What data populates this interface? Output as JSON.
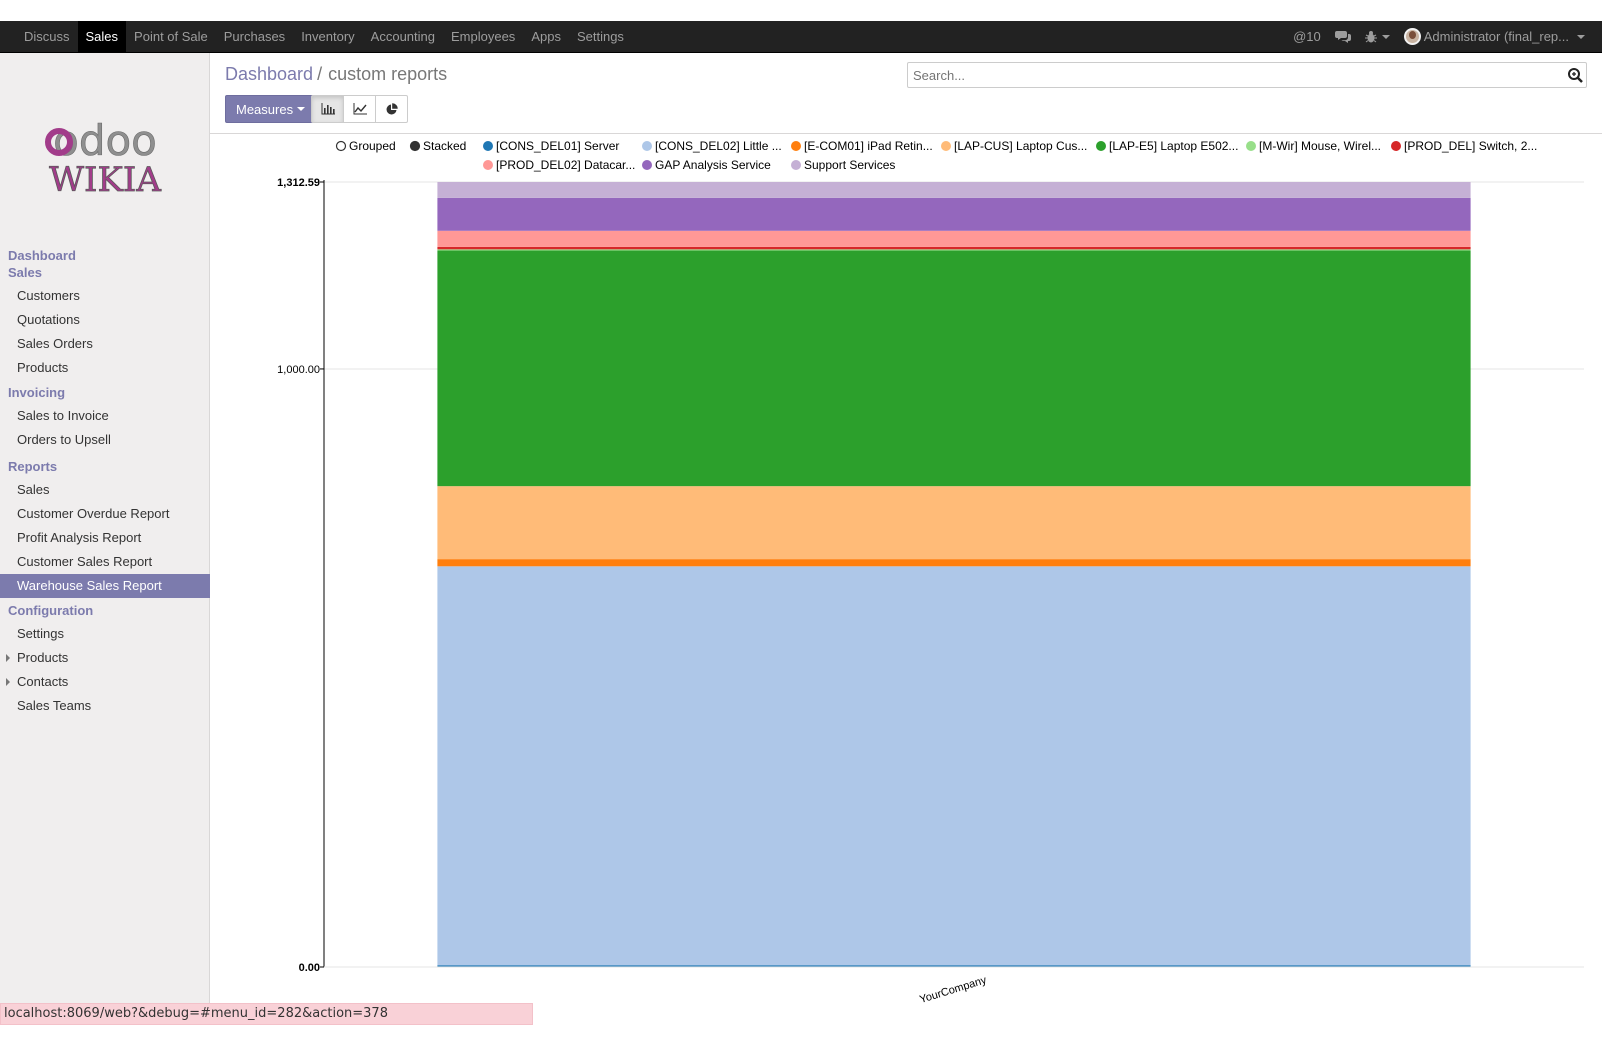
{
  "topbar": {
    "menu": [
      "Discuss",
      "Sales",
      "Point of Sale",
      "Purchases",
      "Inventory",
      "Accounting",
      "Employees",
      "Apps",
      "Settings"
    ],
    "active": "Sales",
    "mentions": "@10",
    "user": "Administrator (final_rep..."
  },
  "sidebar": {
    "logo_line1": "odoo",
    "logo_line2": "WIKIA",
    "sections": [
      {
        "title": "Dashboard",
        "items": []
      },
      {
        "title": "Sales",
        "items": [
          "Customers",
          "Quotations",
          "Sales Orders",
          "Products"
        ]
      },
      {
        "title": "Invoicing",
        "items": [
          "Sales to Invoice",
          "Orders to Upsell"
        ]
      },
      {
        "title": "Reports",
        "items": [
          "Sales",
          "Customer Overdue Report",
          "Profit Analysis Report",
          "Customer Sales Report",
          "Warehouse Sales Report"
        ]
      },
      {
        "title": "Configuration",
        "items": [
          "Settings",
          "Products",
          "Contacts",
          "Sales Teams"
        ]
      }
    ],
    "active_item": "Warehouse Sales Report"
  },
  "control": {
    "breadcrumb_link": "Dashboard",
    "breadcrumb_sep": "/",
    "breadcrumb_current": "custom reports",
    "search_placeholder": "Search...",
    "measures_label": "Measures"
  },
  "chart_data": {
    "type": "bar",
    "stacked": true,
    "legend_mode_options": [
      "Grouped",
      "Stacked"
    ],
    "legend_mode_selected": "Stacked",
    "categories": [
      "YourCompany"
    ],
    "y_ticks": [
      "0.00",
      "1,000.00",
      "1,312.59"
    ],
    "ylim": [
      0,
      1312.59
    ],
    "series": [
      {
        "name": "[CONS_DEL01] Server",
        "color": "#1f77b4",
        "values": [
          3
        ]
      },
      {
        "name": "[CONS_DEL02] Little ...",
        "color": "#aec7e8",
        "values": [
          667
        ]
      },
      {
        "name": "[E-COM01] iPad Retin...",
        "color": "#ff7f0e",
        "values": [
          12
        ]
      },
      {
        "name": "[LAP-CUS] Laptop Cus...",
        "color": "#ffbb78",
        "values": [
          122
        ]
      },
      {
        "name": "[LAP-E5] Laptop E502...",
        "color": "#2ca02c",
        "values": [
          394
        ]
      },
      {
        "name": "[M-Wir] Mouse, Wirel...",
        "color": "#98df8a",
        "values": [
          2
        ]
      },
      {
        "name": "[PROD_DEL] Switch, 2...",
        "color": "#d62728",
        "values": [
          4
        ]
      },
      {
        "name": "[PROD_DEL02] Datacar...",
        "color": "#ff9896",
        "values": [
          27
        ]
      },
      {
        "name": "GAP Analysis Service",
        "color": "#9467bd",
        "values": [
          55
        ]
      },
      {
        "name": "Support Services",
        "color": "#c5b0d5",
        "values": [
          26.59
        ]
      }
    ]
  },
  "status_url": "localhost:8069/web?&debug=#menu_id=282&action=378"
}
